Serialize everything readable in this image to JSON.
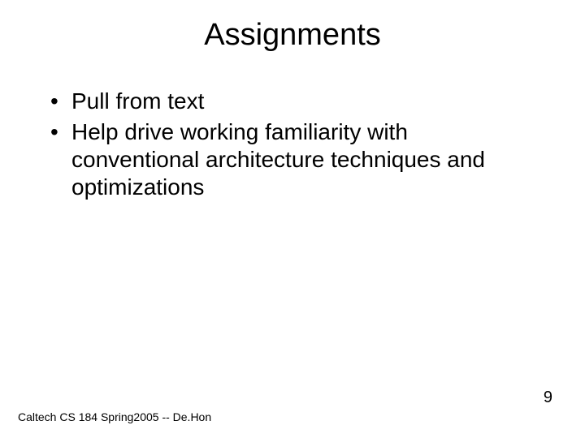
{
  "slide": {
    "title": "Assignments",
    "bullets": [
      "Pull from text",
      "Help drive working familiarity with conventional architecture techniques and optimizations"
    ],
    "footer": "Caltech CS 184 Spring2005 -- De.Hon",
    "page_number": "9"
  }
}
